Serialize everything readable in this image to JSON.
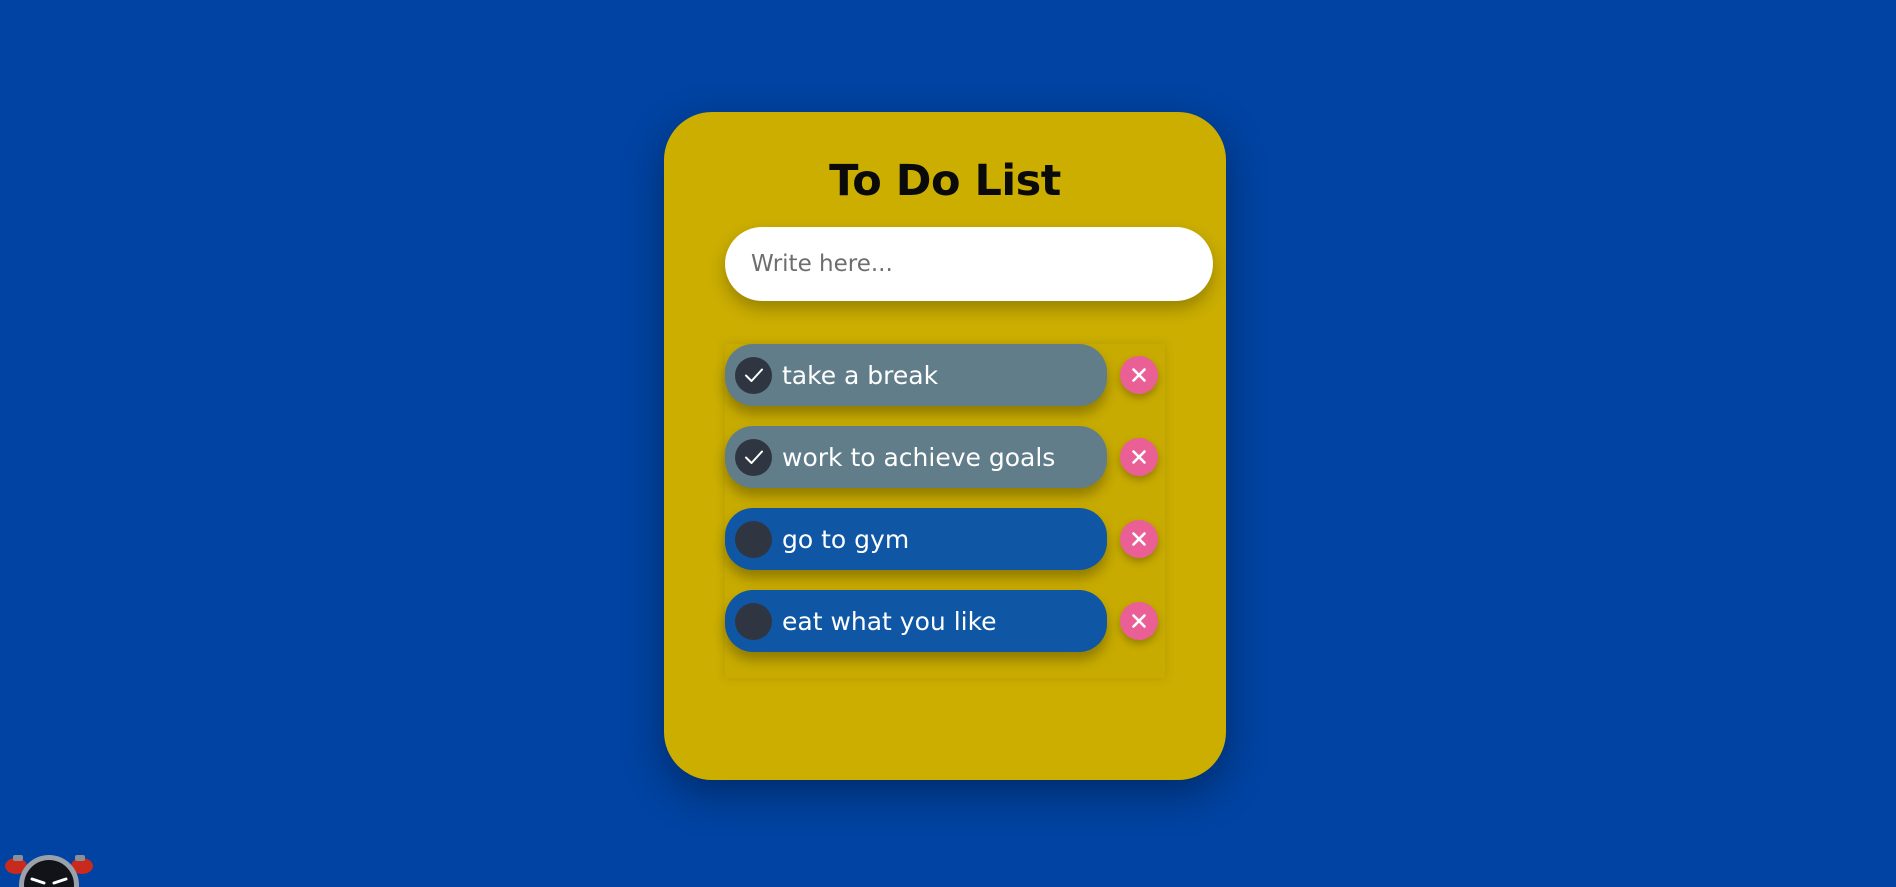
{
  "app": {
    "title": "To Do List"
  },
  "input": {
    "placeholder": "Write here...",
    "value": ""
  },
  "tasks": [
    {
      "label": "take a break",
      "completed": true
    },
    {
      "label": "work to achieve goals",
      "completed": true
    },
    {
      "label": "go to gym",
      "completed": false
    },
    {
      "label": "eat what you like",
      "completed": false
    }
  ],
  "icons": {
    "check": "checkmark-icon",
    "delete": "close-icon",
    "mascot": "robot-mascot-icon"
  },
  "colors": {
    "background": "#0043a2",
    "card": "#cbae00",
    "task_done": "#617d8a",
    "task_pending": "#0f56a5",
    "delete_button": "#eb5f97",
    "check_circle": "#303641"
  }
}
